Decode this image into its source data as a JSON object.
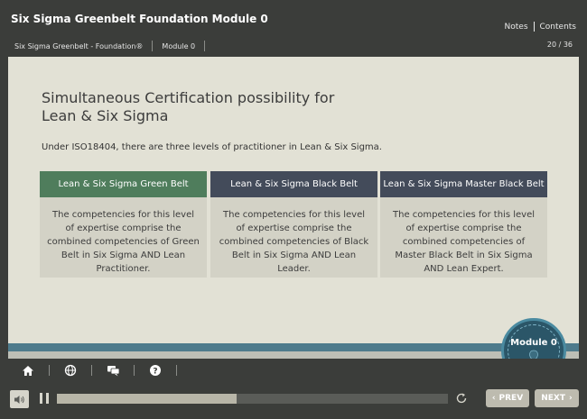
{
  "header": {
    "course_title": "Six Sigma Greenbelt Foundation Module 0",
    "notes_label": "Notes",
    "contents_label": "Contents",
    "breadcrumb": [
      "Six Sigma Greenbelt - Foundation®",
      "Module 0"
    ],
    "page_indicator": "20 / 36"
  },
  "slide": {
    "title": "Simultaneous Certification possibility for Lean & Six Sigma",
    "subtitle": "Under ISO18404, there are three levels of practitioner in Lean & Six Sigma.",
    "cards": [
      {
        "heading": "Lean & Six Sigma Green Belt",
        "body": "The competencies for this level of expertise comprise the combined competencies of Green Belt in Six Sigma AND Lean Practitioner."
      },
      {
        "heading": "Lean & Six Sigma Black Belt",
        "body": "The competencies for this level of expertise comprise the combined competencies of Black Belt in Six Sigma AND Lean Leader."
      },
      {
        "heading": "Lean & Six Sigma Master Black Belt",
        "body": "The competencies for this level of expertise comprise the combined competencies of Master Black Belt in Six Sigma AND Lean Expert."
      }
    ],
    "badge_label": "Module 0"
  },
  "toolbar": {
    "icons": [
      "home-icon",
      "globe-icon",
      "chat-icon",
      "help-icon"
    ]
  },
  "player": {
    "progress": 0.46,
    "prev_label": "PREV",
    "next_label": "NEXT"
  },
  "colors": {
    "background": "#3b3d3a",
    "slide": "#e2e1d5",
    "green_header": "#4f7d5c",
    "slate_header": "#434b5a",
    "accent_teal": "#4e7b8c"
  }
}
